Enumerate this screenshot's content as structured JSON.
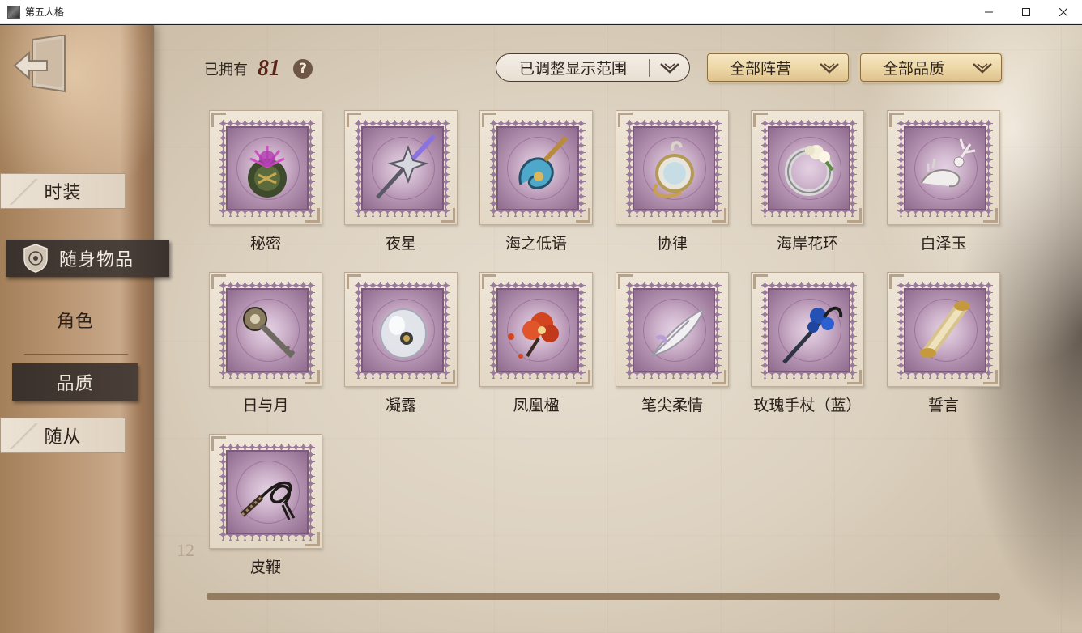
{
  "window": {
    "title": "第五人格"
  },
  "toolbar": {
    "owned_label": "已拥有",
    "owned_count": "81",
    "help_glyph": "?",
    "range_filter": "已调整显示范围",
    "camp_filter": "全部阵营",
    "quality_filter": "全部品质"
  },
  "sidebar": {
    "tabs": {
      "costume": "时装",
      "accessory": "随身物品",
      "character": "角色",
      "quality": "品质",
      "follower": "随从"
    },
    "active_tab": "随身物品",
    "active_sub_tab": "品质"
  },
  "items": [
    {
      "name": "秘密",
      "icon": "thistle-icon"
    },
    {
      "name": "夜星",
      "icon": "star-scepter-icon"
    },
    {
      "name": "海之低语",
      "icon": "sea-shell-staff-icon"
    },
    {
      "name": "协律",
      "icon": "pocket-watch-icon"
    },
    {
      "name": "海岸花环",
      "icon": "flower-wreath-icon"
    },
    {
      "name": "白泽玉",
      "icon": "jade-deer-icon"
    },
    {
      "name": "日与月",
      "icon": "sun-key-icon"
    },
    {
      "name": "凝露",
      "icon": "dew-orb-icon"
    },
    {
      "name": "凤凰楹",
      "icon": "phoenix-flower-icon"
    },
    {
      "name": "笔尖柔情",
      "icon": "feather-pen-icon"
    },
    {
      "name": "玫瑰手杖（蓝）",
      "icon": "blue-rose-cane-icon"
    },
    {
      "name": "誓言",
      "icon": "scroll-icon"
    },
    {
      "name": "皮鞭",
      "icon": "whip-icon"
    }
  ],
  "colors": {
    "stamp_purple": "#9a7a9a",
    "active_tab_bg": "#3a312c",
    "count_red": "#5a2418",
    "gold_dropdown": "#edd8a7"
  },
  "scroll_fraction": 1.0
}
